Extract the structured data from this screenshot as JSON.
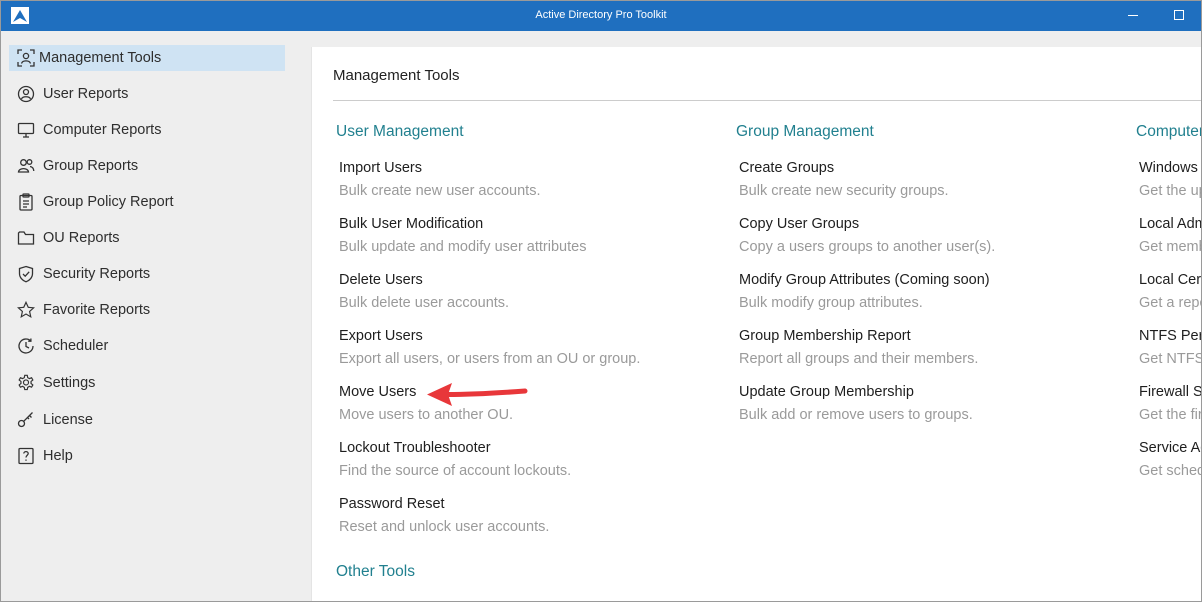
{
  "window": {
    "title": "Active Directory Pro Toolkit",
    "accent": "#1f6fbf"
  },
  "sidebar": {
    "items": [
      {
        "label": "Management Tools",
        "icon": "management-tools-icon",
        "active": true
      },
      {
        "label": "User Reports",
        "icon": "user-circle-icon"
      },
      {
        "label": "Computer Reports",
        "icon": "monitor-icon"
      },
      {
        "label": "Group Reports",
        "icon": "group-users-icon"
      },
      {
        "label": "Group Policy Report",
        "icon": "clipboard-icon"
      },
      {
        "label": "OU Reports",
        "icon": "folder-icon"
      },
      {
        "label": "Security Reports",
        "icon": "shield-check-icon"
      },
      {
        "label": "Favorite Reports",
        "icon": "star-icon"
      },
      {
        "label": "Scheduler",
        "icon": "clock-icon"
      },
      {
        "label": "Settings",
        "icon": "gear-icon"
      },
      {
        "label": "License",
        "icon": "key-icon"
      },
      {
        "label": "Help",
        "icon": "help-icon"
      }
    ]
  },
  "main": {
    "title": "Management Tools",
    "sections": {
      "user_management": {
        "heading": "User Management",
        "tools": [
          {
            "title": "Import Users",
            "desc": "Bulk create new user accounts."
          },
          {
            "title": "Bulk User Modification",
            "desc": "Bulk update and modify user attributes"
          },
          {
            "title": "Delete Users",
            "desc": "Bulk delete user accounts."
          },
          {
            "title": "Export Users",
            "desc": "Export all users, or users from an OU or group."
          },
          {
            "title": "Move Users",
            "desc": "Move users to another OU."
          },
          {
            "title": "Lockout Troubleshooter",
            "desc": "Find the source of account lockouts."
          },
          {
            "title": "Password Reset",
            "desc": "Reset and unlock user accounts."
          }
        ]
      },
      "group_management": {
        "heading": "Group Management",
        "tools": [
          {
            "title": "Create Groups",
            "desc": "Bulk create new security groups."
          },
          {
            "title": "Copy User Groups",
            "desc": "Copy a users groups to another user(s)."
          },
          {
            "title": "Modify Group Attributes (Coming soon)",
            "desc": "Bulk modify group attributes."
          },
          {
            "title": "Group Membership Report",
            "desc": "Report all groups and their members."
          },
          {
            "title": "Update Group Membership",
            "desc": "Bulk add or remove users to groups."
          }
        ]
      },
      "computer_management": {
        "heading": "Computer",
        "tools": [
          {
            "title": "Windows",
            "desc": "Get the up"
          },
          {
            "title": "Local Adm",
            "desc": "Get memb"
          },
          {
            "title": "Local Cer",
            "desc": "Get a repo"
          },
          {
            "title": "NTFS Per",
            "desc": "Get NTFS"
          },
          {
            "title": "Firewall S",
            "desc": "Get the fir"
          },
          {
            "title": "Service Ac",
            "desc": "Get sched"
          }
        ]
      },
      "other_tools": {
        "heading": "Other Tools"
      }
    }
  },
  "annotation": {
    "arrow_color": "#e8373a"
  }
}
